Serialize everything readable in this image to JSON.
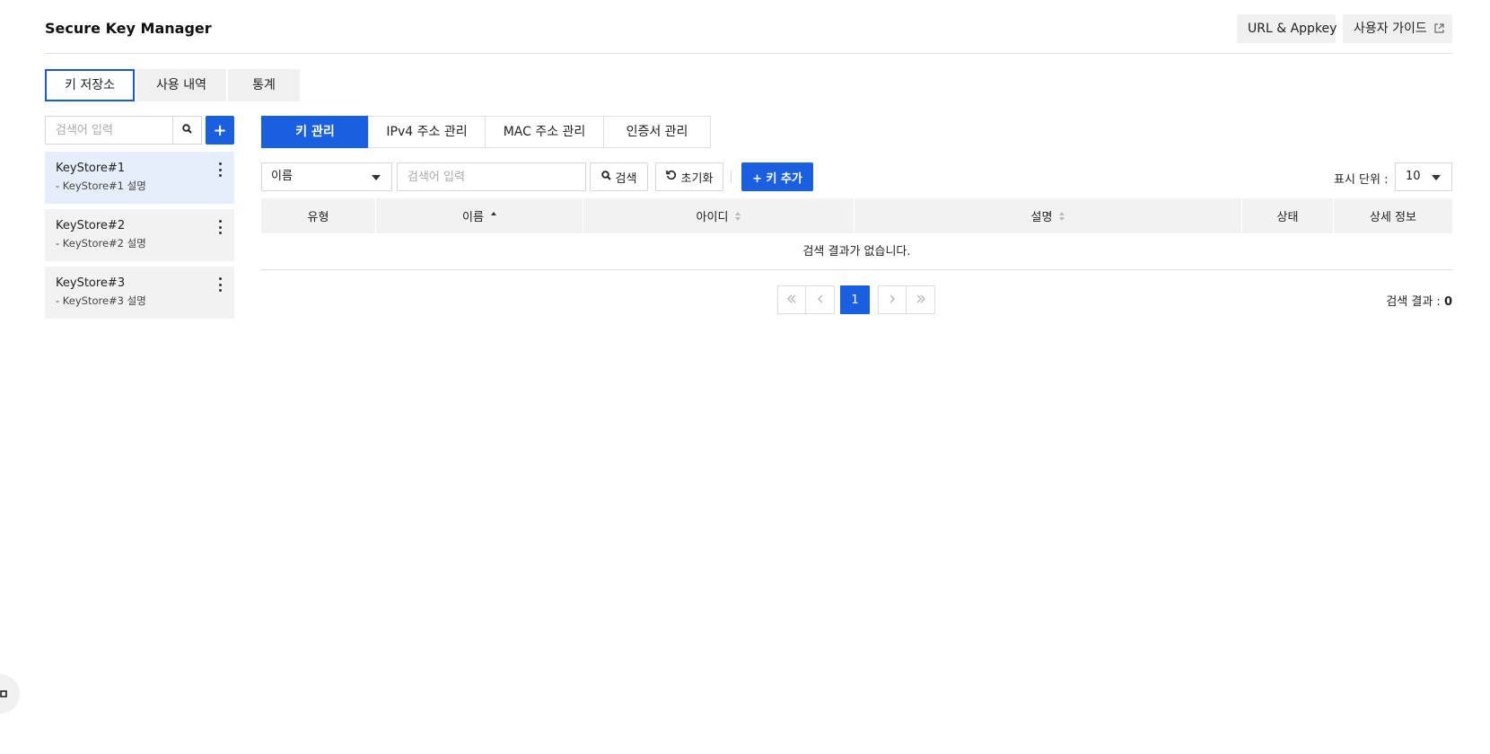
{
  "header": {
    "title": "Secure Key Manager",
    "url_appkey_label": "URL & Appkey",
    "user_guide_label": "사용자 가이드"
  },
  "main_tabs": [
    {
      "label": "키 저장소",
      "active": true
    },
    {
      "label": "사용 내역",
      "active": false
    },
    {
      "label": "통계",
      "active": false
    }
  ],
  "sidebar": {
    "search_placeholder": "검색어 입력",
    "keystores": [
      {
        "name": "KeyStore#1",
        "description": "- KeyStore#1 설명",
        "selected": true
      },
      {
        "name": "KeyStore#2",
        "description": "- KeyStore#2 설명",
        "selected": false
      },
      {
        "name": "KeyStore#3",
        "description": "- KeyStore#3 설명",
        "selected": false
      }
    ]
  },
  "sub_tabs": [
    {
      "label": "키 관리",
      "active": true
    },
    {
      "label": "IPv4 주소 관리",
      "active": false
    },
    {
      "label": "MAC 주소 관리",
      "active": false
    },
    {
      "label": "인증서 관리",
      "active": false
    }
  ],
  "toolbar": {
    "filter_field": "이름",
    "search_placeholder": "검색어 입력",
    "search_label": "검색",
    "reset_label": "초기화",
    "add_key_label": "+ 키 추가",
    "page_size_label": "표시 단위 :",
    "page_size_value": "10"
  },
  "grid": {
    "columns": [
      {
        "label": "유형",
        "sortable": false
      },
      {
        "label": "이름",
        "sortable": true,
        "sort": "asc"
      },
      {
        "label": "아이디",
        "sortable": true
      },
      {
        "label": "설명",
        "sortable": true
      },
      {
        "label": "상태",
        "sortable": false
      },
      {
        "label": "상세 정보",
        "sortable": false
      }
    ],
    "empty_message": "검색 결과가 없습니다."
  },
  "pagination": {
    "current_page": "1",
    "result_label": "검색 결과 :",
    "result_count": "0"
  },
  "colors": {
    "primary": "#1a5fe0",
    "selected_item_bg": "#e6eefc",
    "muted_bg": "#f2f2f2"
  }
}
